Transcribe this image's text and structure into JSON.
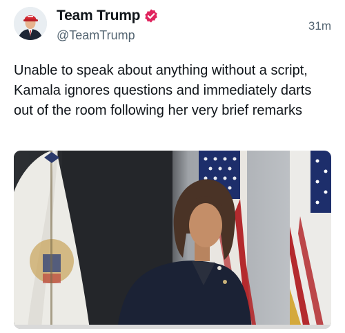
{
  "author": {
    "display_name": "Team Trump",
    "handle": "@TeamTrump",
    "verified": true,
    "avatar_icon": "profile-photo-man-red-cap"
  },
  "timestamp": "31m",
  "tweet": {
    "text": "Unable to speak about anything without a script, Kamala ignores questions and immediately darts out of the room following her very brief remarks"
  },
  "media": {
    "type": "video-still",
    "description_icon": "woman-in-navy-suit-in-front-of-flags"
  },
  "colors": {
    "verified_badge": "#e0245e",
    "secondary_text": "#536471",
    "primary_text": "#0f1419"
  }
}
